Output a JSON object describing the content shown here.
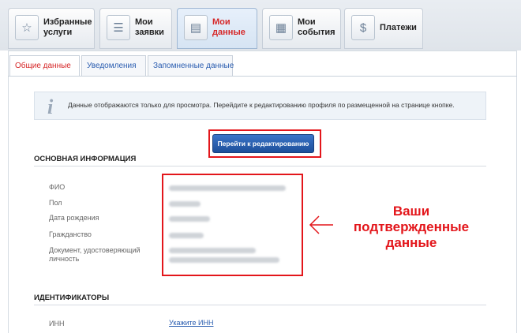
{
  "nav": {
    "tabs": [
      {
        "label": "Избранные\nуслуги",
        "icon": "favorites-icon",
        "active": false
      },
      {
        "label": "Мои\nзаявки",
        "icon": "requests-icon",
        "active": false
      },
      {
        "label": "Мои\nданные",
        "icon": "my-data-icon",
        "active": true
      },
      {
        "label": "Мои\nсобытия",
        "icon": "calendar-icon",
        "active": false
      },
      {
        "label": "Платежи",
        "icon": "payments-icon",
        "active": false
      }
    ]
  },
  "subtabs": [
    "Общие данные",
    "Уведомления",
    "Запомненные данные"
  ],
  "info": {
    "icon": "info-icon",
    "text": "Данные отображаются только для просмотра. Перейдите к редактированию профиля по размещенной на странице кнопке."
  },
  "edit_button": "Перейти к редактированию",
  "main_section": {
    "title": "ОСНОВНАЯ ИНФОРМАЦИЯ",
    "fields": [
      {
        "label": "ФИО"
      },
      {
        "label": "Пол"
      },
      {
        "label": "Дата рождения"
      },
      {
        "label": "Гражданство"
      },
      {
        "label": "Документ, удостоверяющий\nличность"
      }
    ]
  },
  "annotation": "Ваши\nподтвержденные\nданные",
  "ids_section": {
    "title": "ИДЕНТИФИКАТОРЫ",
    "inn_label": "ИНН",
    "inn_link": "Укажите ИНН"
  },
  "colors": {
    "accent_red": "#e3161b",
    "link_blue": "#2a5db0",
    "button_blue": "#1d4f9a"
  }
}
